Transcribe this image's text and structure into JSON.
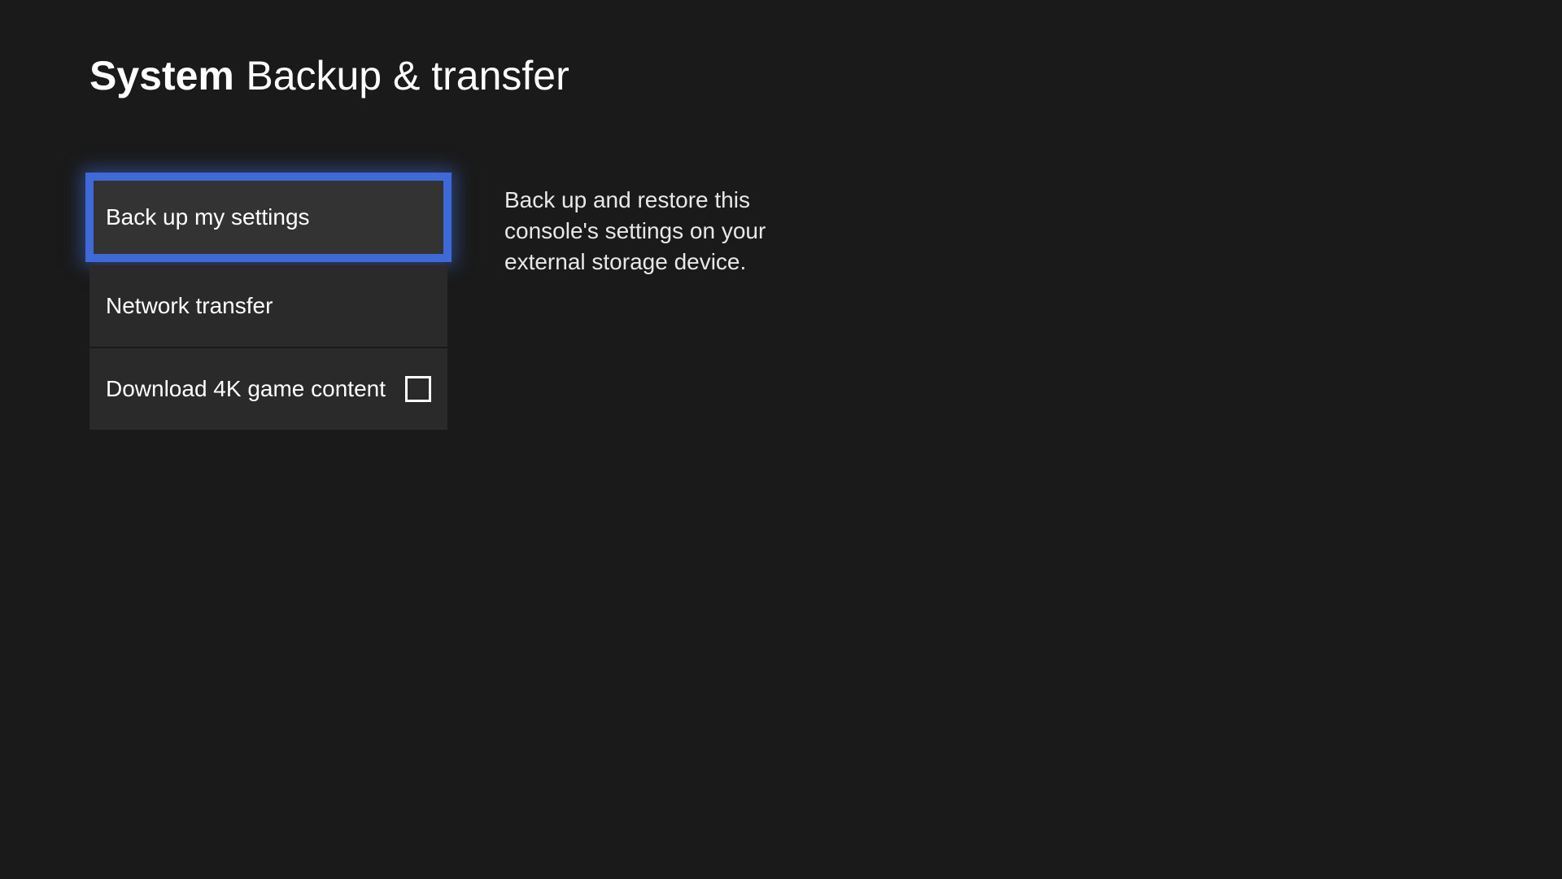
{
  "header": {
    "category": "System",
    "page": "Backup & transfer"
  },
  "menu": {
    "items": [
      {
        "label": "Back up my settings",
        "selected": true,
        "hasCheckbox": false
      },
      {
        "label": "Network transfer",
        "selected": false,
        "hasCheckbox": false
      },
      {
        "label": "Download 4K game content",
        "selected": false,
        "hasCheckbox": true,
        "checked": false
      }
    ]
  },
  "description": {
    "text": "Back up and restore this console's settings on your external storage device."
  }
}
